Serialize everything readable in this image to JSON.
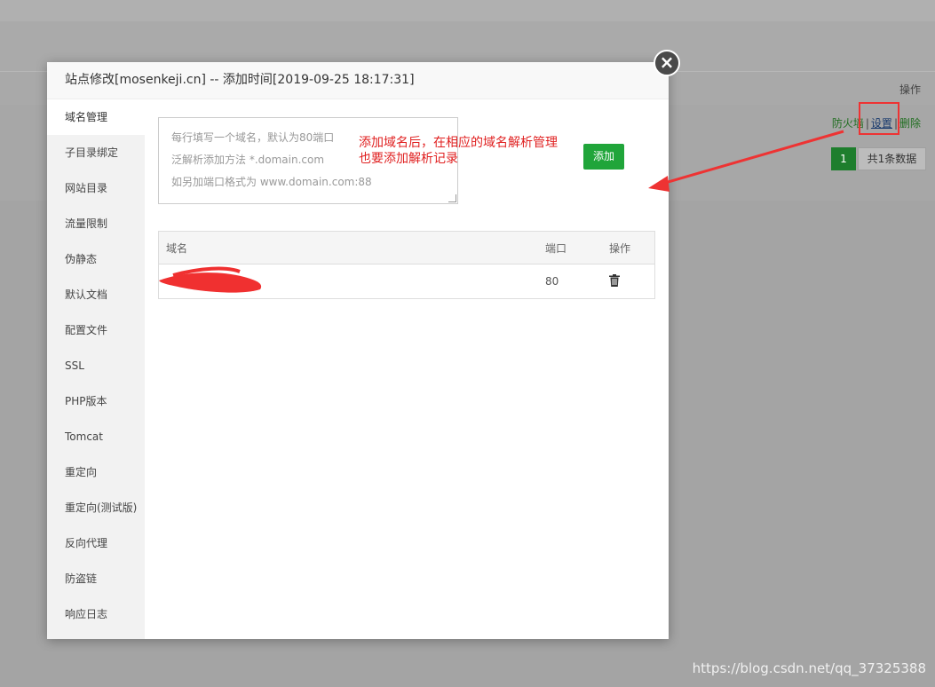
{
  "background": {
    "op_header": "操作",
    "links": {
      "firewall": "防火墙",
      "sep1": "|",
      "settings": "设置",
      "sep2": "|",
      "delete": "删除"
    },
    "pager": {
      "current_page": "1",
      "total": "共1条数据"
    }
  },
  "modal": {
    "title": "站点修改[mosenkeji.cn] -- 添加时间[2019-09-25 18:17:31]",
    "close_label": "×",
    "sidebar": [
      {
        "label": "域名管理",
        "active": true
      },
      {
        "label": "子目录绑定"
      },
      {
        "label": "网站目录"
      },
      {
        "label": "流量限制"
      },
      {
        "label": "伪静态"
      },
      {
        "label": "默认文档"
      },
      {
        "label": "配置文件"
      },
      {
        "label": "SSL"
      },
      {
        "label": "PHP版本"
      },
      {
        "label": "Tomcat"
      },
      {
        "label": "重定向"
      },
      {
        "label": "重定向(测试版)"
      },
      {
        "label": "反向代理"
      },
      {
        "label": "防盗链"
      },
      {
        "label": "响应日志"
      }
    ],
    "domain_input": {
      "placeholder_lines": [
        "每行填写一个域名，默认为80端口",
        "泛解析添加方法 *.domain.com",
        "如另加端口格式为 www.domain.com:88"
      ]
    },
    "add_button": "添加",
    "annotation": [
      "添加域名后，在相应的域名解析管理",
      "也要添加解析记录"
    ],
    "table": {
      "headers": {
        "domain": "域名",
        "port": "端口",
        "action": "操作"
      },
      "rows": [
        {
          "domain": "",
          "port": "80"
        }
      ]
    }
  },
  "watermark": "https://blog.csdn.net/qq_37325388"
}
